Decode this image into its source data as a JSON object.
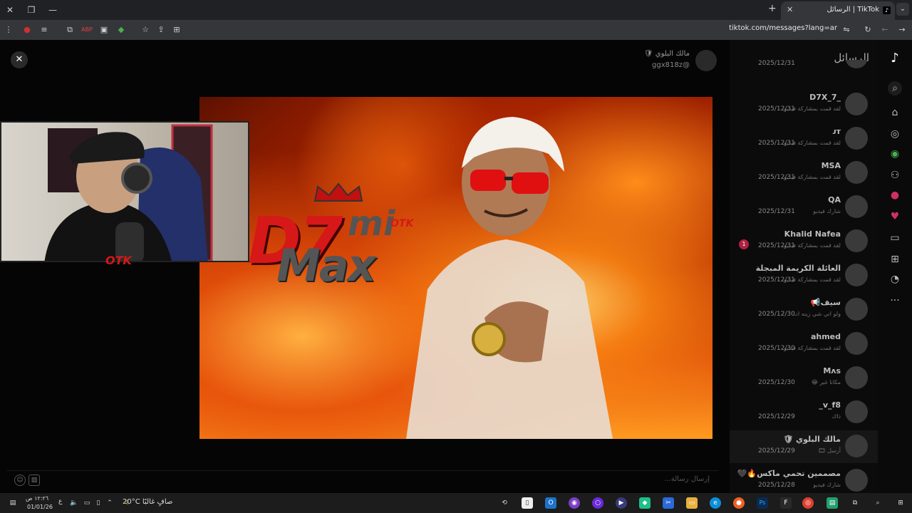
{
  "browser": {
    "tab_title": "الرسائل | TikTok",
    "url": "tiktok.com/messages?lang=ar"
  },
  "inbox": {
    "title": "الرسائل",
    "conversations": [
      {
        "name": "",
        "sub": "",
        "date": "2025/12/31"
      },
      {
        "name": "_D7X_7",
        "sub": "لقد قمت بمشاركة فيديو",
        "date": "2025/12/31"
      },
      {
        "name": "ᴊᴛ",
        "sub": "لقد قمت بمشاركة فيديو",
        "date": "2025/12/31"
      },
      {
        "name": "MSA",
        "sub": "لقد قمت بمشاركة فيديو",
        "date": "2025/12/31"
      },
      {
        "name": "QA",
        "sub": "شارك فيديو",
        "date": "2025/12/31"
      },
      {
        "name": "Khalid Nafea",
        "sub": "لقد قمت بمشاركة فيديو",
        "date": "2025/12/31"
      },
      {
        "name": "العائلة الكريمة المبجلة",
        "sub": "لقد قمت بمشاركة فيديو",
        "date": "2025/12/31"
      },
      {
        "name": "سيف📢",
        "sub": "ولو اني شي زينه انـ",
        "date": "2025/12/30"
      },
      {
        "name": "ahmed",
        "sub": "لقد قمت بمشاركة فيديو",
        "date": "2025/12/30"
      },
      {
        "name": "Mʌs",
        "sub": "مكانا غير 😂",
        "date": "2025/12/30"
      },
      {
        "name": "v_f8_",
        "sub": "ذاك",
        "date": "2025/12/29"
      },
      {
        "name": "مالك البلوي 🛡",
        "sub": "أرسل 🎞",
        "date": "2025/12/29"
      },
      {
        "name": "مصممين تحمي ماكس🔥🖤",
        "sub": "شارك فيديو",
        "date": "2025/12/28"
      }
    ],
    "unread_badge": "1"
  },
  "chat": {
    "name": "مالك البلوي 🛡",
    "handle": "ggx818z@",
    "input_placeholder": "إرسال رسالة..."
  },
  "thumbnail": {
    "logo_d7": "D7",
    "logo_mi": "mi",
    "logo_max": "Max",
    "logo_tag": "OTK"
  },
  "webcam": {
    "tag": "OTK"
  },
  "taskbar": {
    "time": "١٢:٢٦ ص",
    "date": "01/01/26",
    "lang": "ع",
    "weather_temp": "20°C",
    "weather_desc": "صافٍ غالبًا"
  },
  "colors": {
    "accent_red": "#d61818",
    "tiktok_bg": "#0b0b0b"
  }
}
